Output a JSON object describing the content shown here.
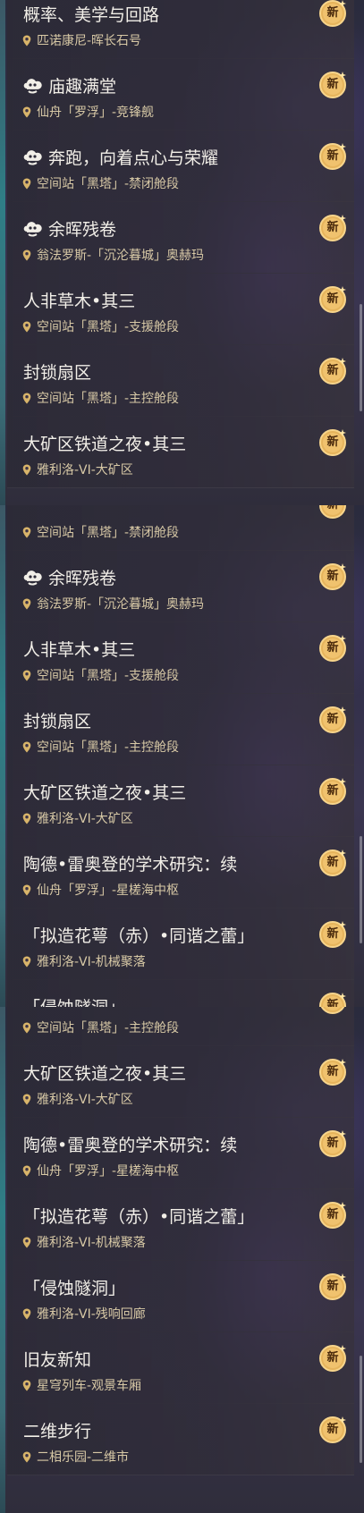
{
  "badge_label": "新",
  "panels": [
    {
      "items": [
        {
          "title": "概率、美学与回路",
          "loc": "匹诺康尼-晖长石号",
          "icon": false
        },
        {
          "title": "庙趣满堂",
          "loc": "仙舟「罗浮」-竞锋舰",
          "icon": true
        },
        {
          "title": "奔跑，向着点心与荣耀",
          "loc": "空间站「黑塔」-禁闭舱段",
          "icon": true
        },
        {
          "title": "余晖残卷",
          "loc": "翁法罗斯-「沉沦暮城」奥赫玛",
          "icon": true
        },
        {
          "title": "人非草木•其三",
          "loc": "空间站「黑塔」-支援舱段",
          "icon": false
        },
        {
          "title": "封锁扇区",
          "loc": "空间站「黑塔」-主控舱段",
          "icon": false
        },
        {
          "title": "大矿区铁道之夜•其三",
          "loc": "雅利洛-VI-大矿区",
          "icon": false
        }
      ]
    },
    {
      "items": [
        {
          "title": "",
          "loc": "空间站「黑塔」-禁闭舱段",
          "icon": false
        },
        {
          "title": "余晖残卷",
          "loc": "翁法罗斯-「沉沦暮城」奥赫玛",
          "icon": true
        },
        {
          "title": "人非草木•其三",
          "loc": "空间站「黑塔」-支援舱段",
          "icon": false
        },
        {
          "title": "封锁扇区",
          "loc": "空间站「黑塔」-主控舱段",
          "icon": false
        },
        {
          "title": "大矿区铁道之夜•其三",
          "loc": "雅利洛-VI-大矿区",
          "icon": false
        },
        {
          "title": "陶德•雷奥登的学术研究：续",
          "loc": "仙舟「罗浮」-星槎海中枢",
          "icon": false
        },
        {
          "title": "「拟造花萼（赤）•同谐之蕾」",
          "loc": "雅利洛-VI-机械聚落",
          "icon": false
        },
        {
          "title": "「侵蚀隧洞」",
          "loc": "",
          "icon": false
        }
      ]
    },
    {
      "items": [
        {
          "title": "",
          "loc": "空间站「黑塔」-主控舱段",
          "icon": false
        },
        {
          "title": "大矿区铁道之夜•其三",
          "loc": "雅利洛-VI-大矿区",
          "icon": false
        },
        {
          "title": "陶德•雷奥登的学术研究：续",
          "loc": "仙舟「罗浮」-星槎海中枢",
          "icon": false
        },
        {
          "title": "「拟造花萼（赤）•同谐之蕾」",
          "loc": "雅利洛-VI-机械聚落",
          "icon": false
        },
        {
          "title": "「侵蚀隧洞」",
          "loc": "雅利洛-VI-残响回廊",
          "icon": false
        },
        {
          "title": "旧友新知",
          "loc": "星穹列车-观景车厢",
          "icon": false
        },
        {
          "title": "二维步行",
          "loc": "二相乐园-二维市",
          "icon": false
        }
      ]
    }
  ]
}
